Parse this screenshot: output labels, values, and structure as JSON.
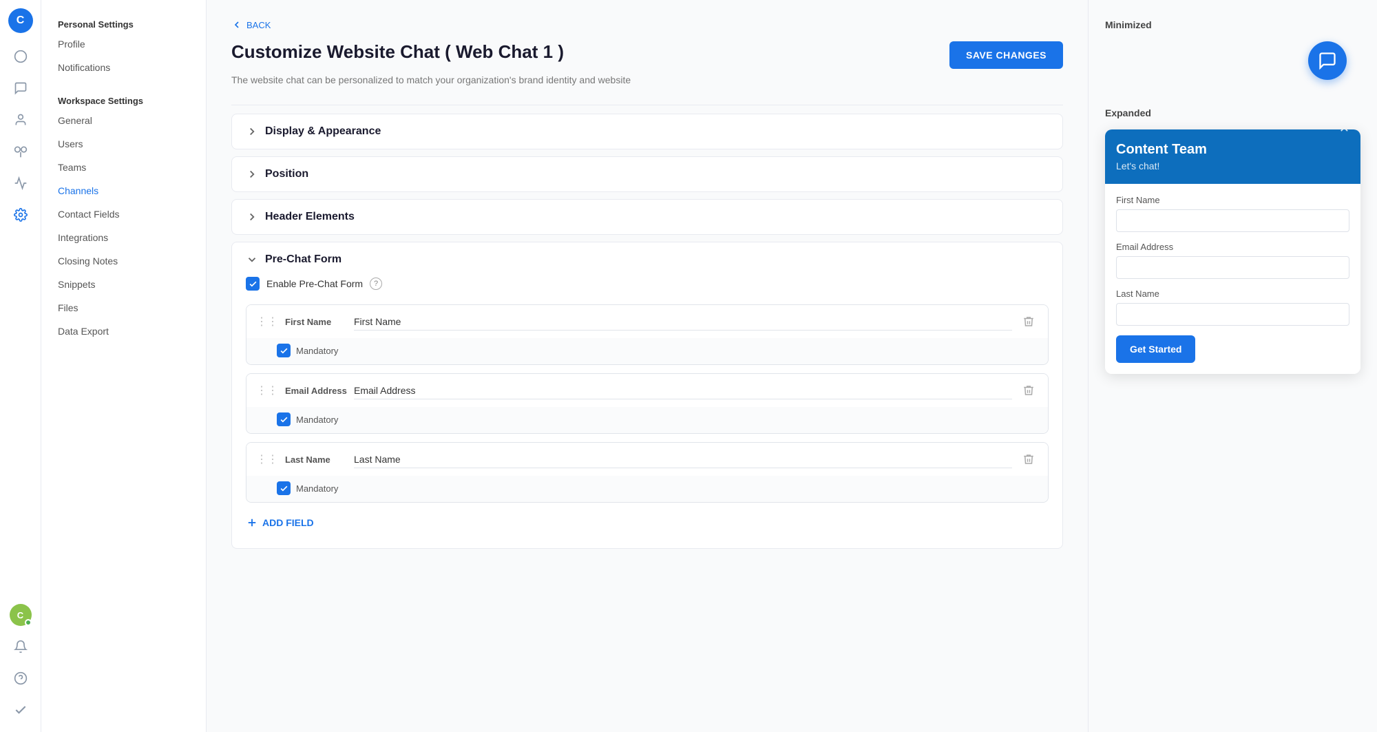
{
  "app": {
    "avatar_letter": "C",
    "avatar_bottom_letter": "C"
  },
  "sidebar": {
    "personal_settings_title": "Personal Settings",
    "workspace_settings_title": "Workspace Settings",
    "personal_items": [
      {
        "label": "Profile",
        "id": "profile",
        "active": false
      },
      {
        "label": "Notifications",
        "id": "notifications",
        "active": false
      }
    ],
    "workspace_items": [
      {
        "label": "General",
        "id": "general",
        "active": false
      },
      {
        "label": "Users",
        "id": "users",
        "active": false
      },
      {
        "label": "Teams",
        "id": "teams",
        "active": false
      },
      {
        "label": "Channels",
        "id": "channels",
        "active": true
      },
      {
        "label": "Contact Fields",
        "id": "contact-fields",
        "active": false
      },
      {
        "label": "Integrations",
        "id": "integrations",
        "active": false
      },
      {
        "label": "Closing Notes",
        "id": "closing-notes",
        "active": false
      },
      {
        "label": "Snippets",
        "id": "snippets",
        "active": false
      },
      {
        "label": "Files",
        "id": "files",
        "active": false
      },
      {
        "label": "Data Export",
        "id": "data-export",
        "active": false
      }
    ]
  },
  "back_label": "BACK",
  "page_title": "Customize Website Chat ( Web Chat 1 )",
  "page_subtitle": "The website chat can be personalized to match your organization's brand identity and website",
  "save_button_label": "SAVE CHANGES",
  "accordions": [
    {
      "id": "display",
      "label": "Display & Appearance",
      "open": false
    },
    {
      "id": "position",
      "label": "Position",
      "open": false
    },
    {
      "id": "header",
      "label": "Header Elements",
      "open": false
    },
    {
      "id": "prechat",
      "label": "Pre-Chat Form",
      "open": true
    }
  ],
  "prechat": {
    "enable_label": "Enable Pre-Chat Form",
    "fields": [
      {
        "id": "first-name",
        "section_label": "First Name",
        "input_value": "First Name",
        "mandatory": true
      },
      {
        "id": "email-address",
        "section_label": "Email Address",
        "input_value": "Email Address",
        "mandatory": true
      },
      {
        "id": "last-name",
        "section_label": "Last Name",
        "input_value": "Last Name",
        "mandatory": true
      }
    ],
    "mandatory_label": "Mandatory",
    "add_field_label": "ADD FIELD"
  },
  "preview": {
    "minimized_title": "Minimized",
    "expanded_title": "Expanded",
    "chat_window_title": "Content Team",
    "chat_window_subtitle": "Let's chat!",
    "fields": [
      {
        "label": "First Name"
      },
      {
        "label": "Email Address"
      },
      {
        "label": "Last Name"
      }
    ],
    "get_started_label": "Get Started"
  },
  "colors": {
    "primary": "#1a73e8",
    "chat_header_bg": "#0d6ebd"
  }
}
